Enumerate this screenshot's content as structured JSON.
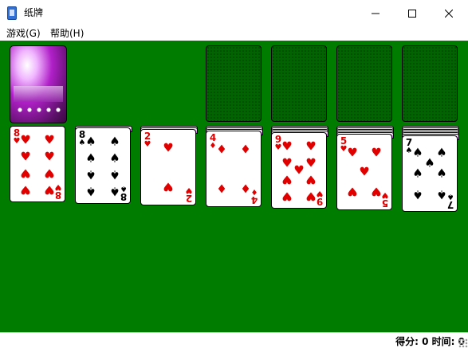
{
  "window": {
    "title": "纸牌"
  },
  "menu": {
    "items": [
      {
        "label": "游戏(G)"
      },
      {
        "label": "帮助(H)"
      }
    ]
  },
  "status": {
    "text": "得分: 0 时间: 0"
  },
  "colors": {
    "felt": "#007c00",
    "red_suit": "#e00000",
    "black_suit": "#000000"
  },
  "foundations": [
    {
      "empty": true
    },
    {
      "empty": true
    },
    {
      "empty": true
    },
    {
      "empty": true
    }
  ],
  "tableau": [
    {
      "hidden": 0,
      "card": {
        "rank": "8",
        "suit": "hearts"
      }
    },
    {
      "hidden": 1,
      "card": {
        "rank": "8",
        "suit": "spades"
      }
    },
    {
      "hidden": 2,
      "card": {
        "rank": "2",
        "suit": "hearts"
      }
    },
    {
      "hidden": 3,
      "card": {
        "rank": "4",
        "suit": "diamonds"
      }
    },
    {
      "hidden": 4,
      "card": {
        "rank": "9",
        "suit": "hearts"
      }
    },
    {
      "hidden": 5,
      "card": {
        "rank": "5",
        "suit": "hearts"
      }
    },
    {
      "hidden": 6,
      "card": {
        "rank": "7",
        "suit": "spades"
      }
    }
  ]
}
